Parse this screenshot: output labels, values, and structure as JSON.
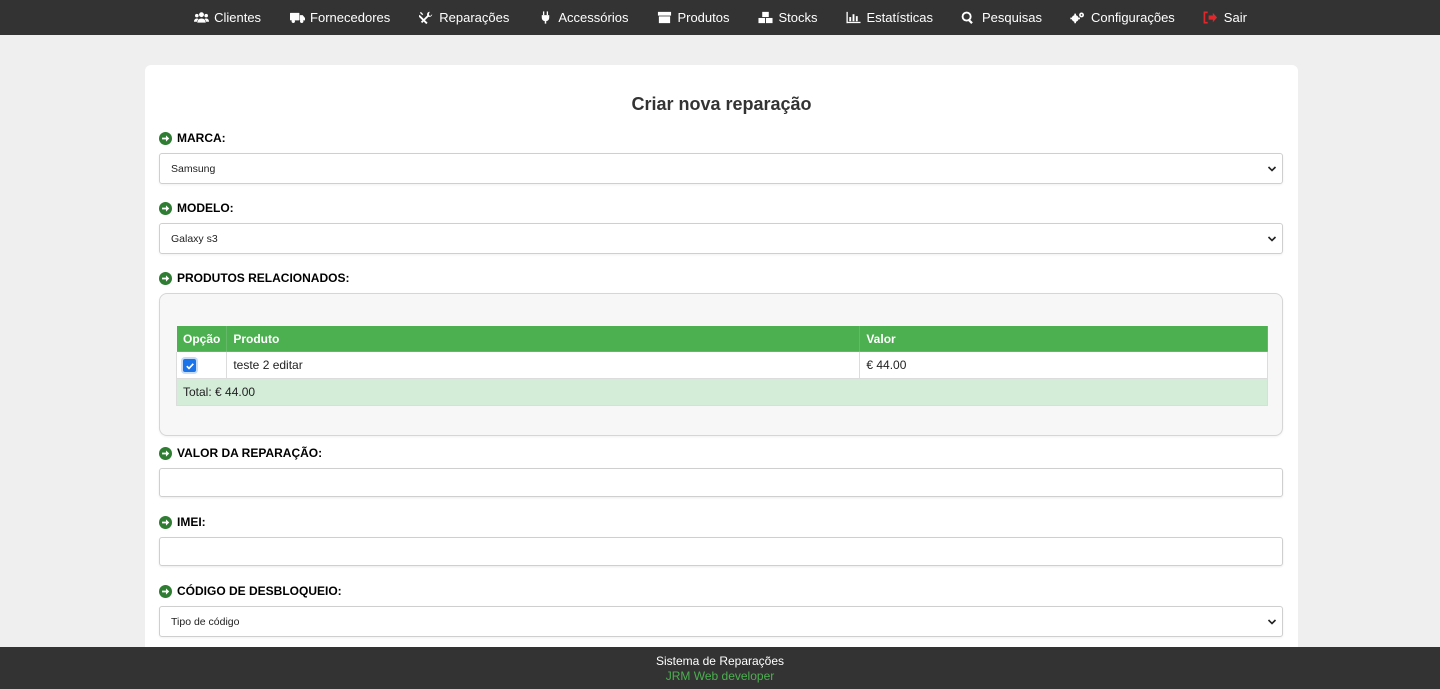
{
  "nav": {
    "items": [
      {
        "label": "Clientes",
        "icon": "users-icon"
      },
      {
        "label": "Fornecedores",
        "icon": "truck-icon"
      },
      {
        "label": "Reparações",
        "icon": "tools-icon"
      },
      {
        "label": "Accessórios",
        "icon": "plug-icon"
      },
      {
        "label": "Produtos",
        "icon": "box-icon"
      },
      {
        "label": "Stocks",
        "icon": "boxes-icon"
      },
      {
        "label": "Estatísticas",
        "icon": "chart-icon"
      },
      {
        "label": "Pesquisas",
        "icon": "search-icon"
      },
      {
        "label": "Configurações",
        "icon": "gears-icon"
      },
      {
        "label": "Sair",
        "icon": "sign-out-icon"
      }
    ]
  },
  "form": {
    "title": "Criar nova reparação",
    "marca_label": "MARCA:",
    "marca_value": "Samsung",
    "modelo_label": "MODELO:",
    "modelo_value": "Galaxy s3",
    "produtos_label": "PRODUTOS RELACIONADOS:",
    "valor_label": "VALOR DA REPARAÇÃO:",
    "valor_value": "",
    "imei_label": "IMEI:",
    "imei_value": "",
    "codigo_label": "CÓDIGO DE DESBLOQUEIO:",
    "codigo_value": "Tipo de código"
  },
  "products_table": {
    "headers": [
      "Opção",
      "Produto",
      "Valor"
    ],
    "rows": [
      {
        "checked": true,
        "produto": "teste 2 editar",
        "valor": "€ 44.00"
      }
    ],
    "total": "Total: € 44.00"
  },
  "footer": {
    "line1": "Sistema de Reparações",
    "line2": "JRM Web developer"
  },
  "colors": {
    "nav_bg": "#333333",
    "accent_green": "#4caf50",
    "logout_red": "#e0282c",
    "arrow_green": "#2e7d32"
  }
}
